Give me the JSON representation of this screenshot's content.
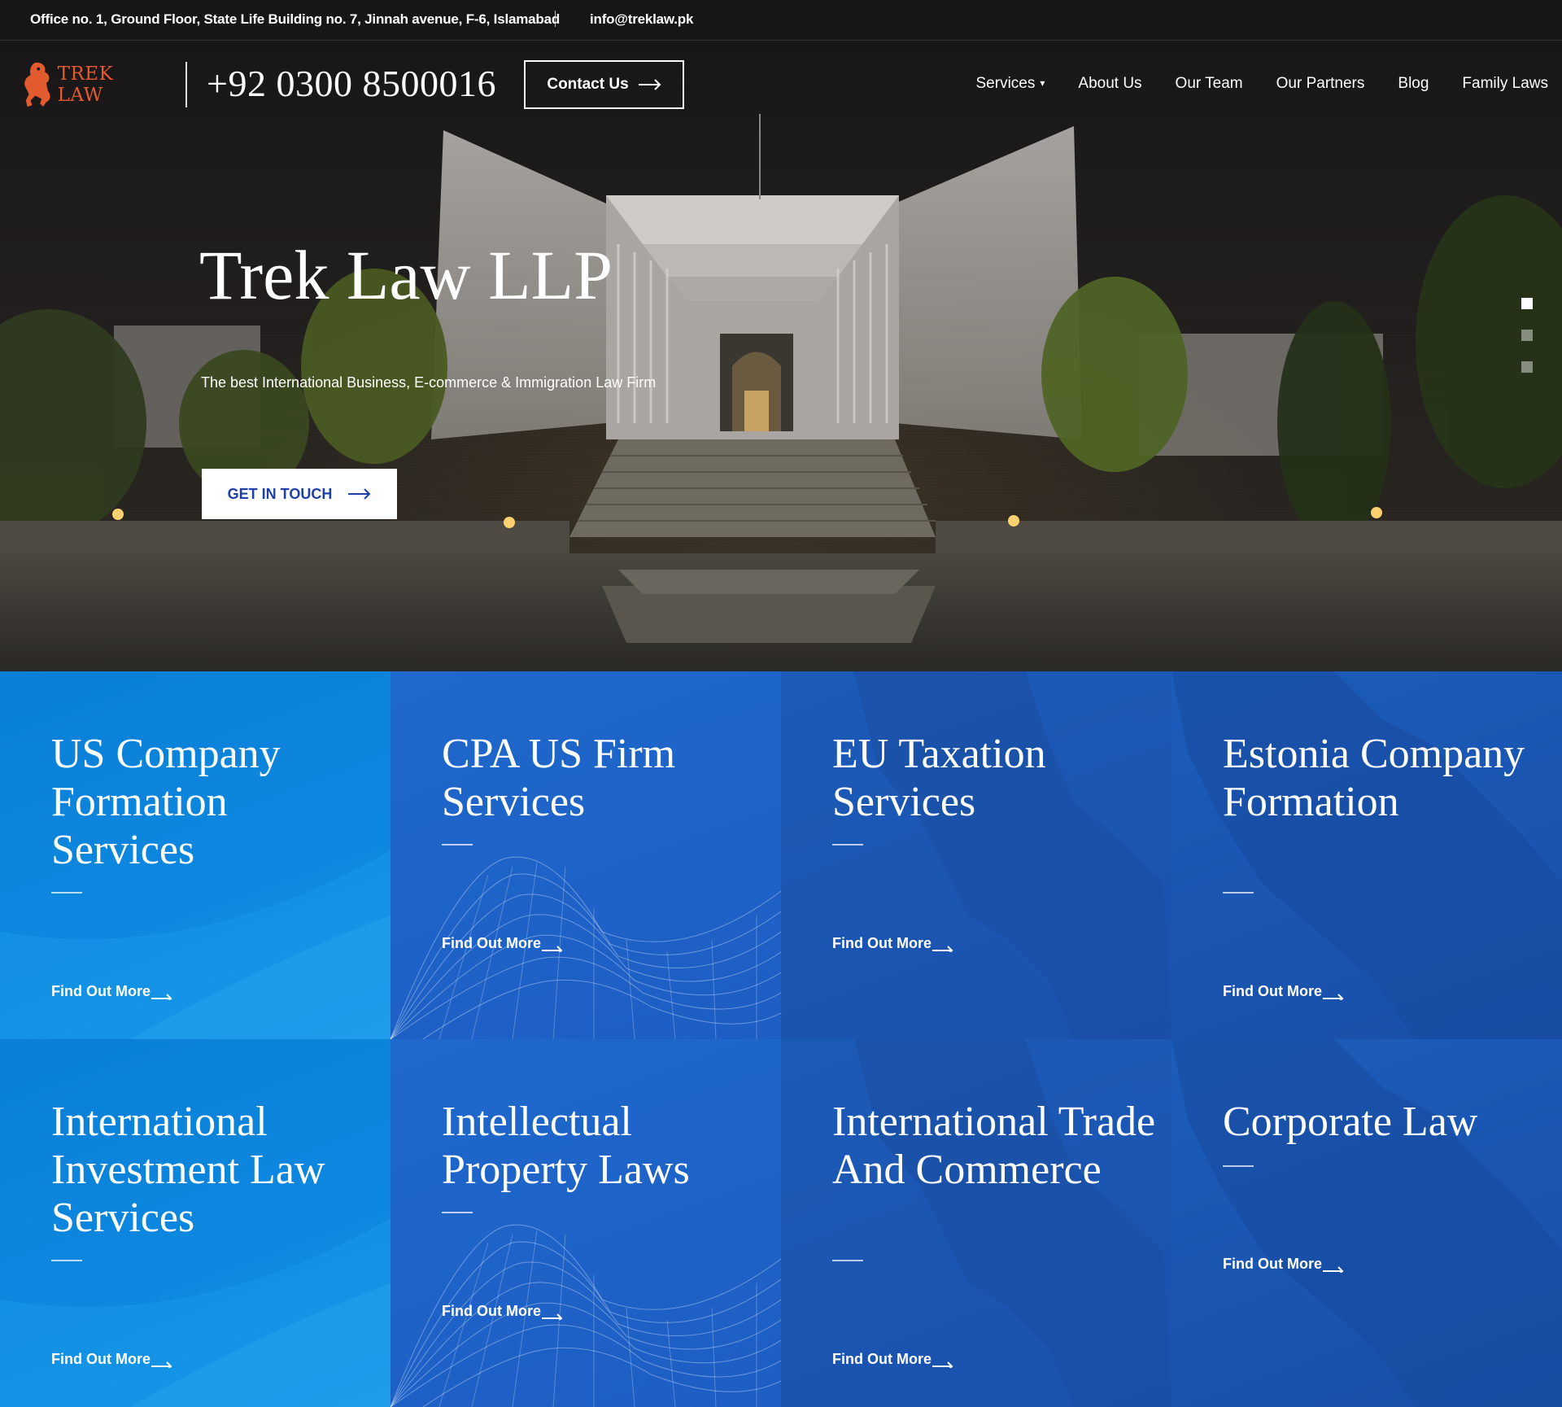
{
  "topbar": {
    "address": "Office no. 1, Ground Floor, State Life Building no. 7, Jinnah avenue, F-6, Islamabad",
    "email": "info@treklaw.pk"
  },
  "header": {
    "logo_text": "TREK LAW",
    "phone": "+92 0300 8500016",
    "contact_label": "Contact Us",
    "nav": [
      "Services",
      "About Us",
      "Our Team",
      "Our Partners",
      "Blog",
      "Family Laws"
    ]
  },
  "hero": {
    "title": "Trek Law LLP",
    "subtitle": "The best International Business, E-commerce & Immigration Law Firm",
    "cta_label": "GET IN TOUCH",
    "slides": 3,
    "active_slide": 1
  },
  "services": [
    {
      "title": "US Company Formation Services",
      "link": "Find Out More"
    },
    {
      "title": "CPA US Firm Services",
      "link": "Find Out More"
    },
    {
      "title": "EU Taxation Services",
      "link": "Find Out More"
    },
    {
      "title": "Estonia Company Formation",
      "link": "Find Out More"
    },
    {
      "title": "International Investment Law Services",
      "link": "Find Out More"
    },
    {
      "title": "Intellectual Property Laws",
      "link": "Find Out More"
    },
    {
      "title": "International Trade And Commerce",
      "link": "Find Out More"
    },
    {
      "title": "Corporate Law",
      "link": "Find Out More"
    }
  ],
  "colors": {
    "logo": "#e25a2e",
    "cta_text": "#1e3fa8",
    "card_light": "#0d88e0",
    "card_mid": "#1d5ec4",
    "card_dark": "#1a52ad"
  },
  "icons": [
    "logo-lion-icon",
    "arrow-right-icon",
    "chevron-down-icon"
  ]
}
